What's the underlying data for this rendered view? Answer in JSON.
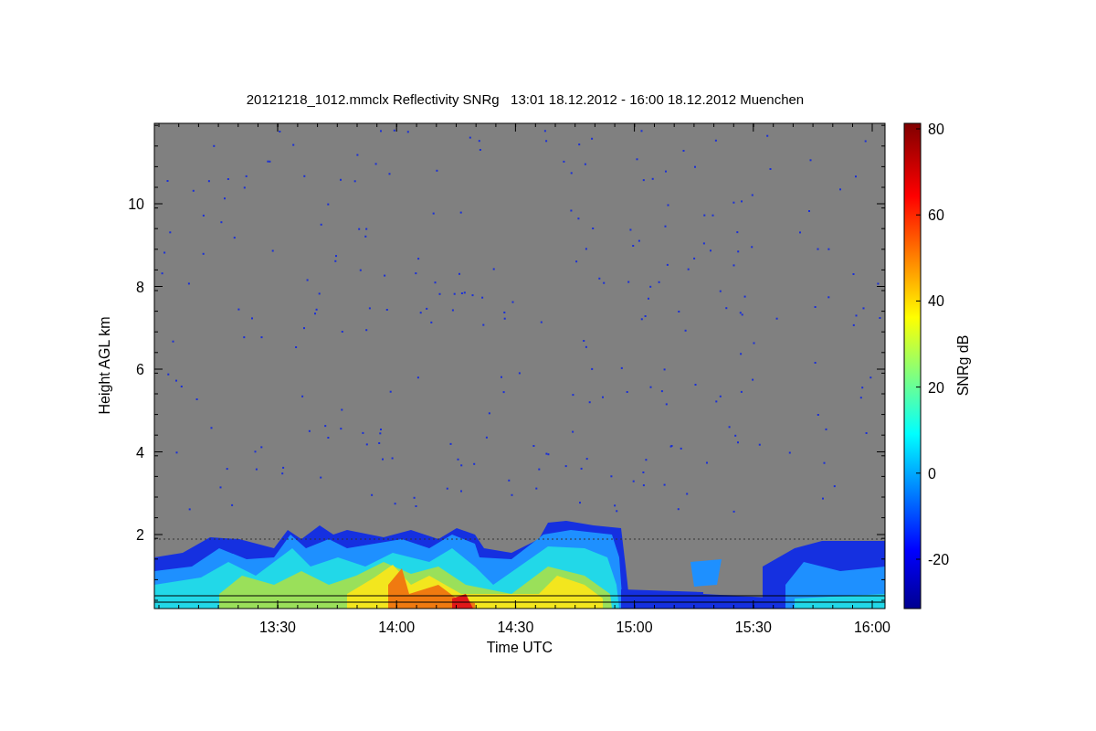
{
  "chart": {
    "title": "20121218_1012.mmclx Reflectivity SNRg   13:01 18.12.2012 - 16:00 18.12.2012 Muenchen",
    "y_axis": {
      "label": "Height AGL km",
      "ticks": [
        "10",
        "8",
        "6",
        "4",
        "2"
      ]
    },
    "x_axis": {
      "label": "Time UTC",
      "ticks": [
        "13:30",
        "14:00",
        "14:30",
        "15:00",
        "15:30",
        "16:00"
      ]
    },
    "colorbar": {
      "label": "SNRg dB",
      "ticks": [
        "80",
        "60",
        "40",
        "20",
        "0",
        "-20"
      ]
    }
  }
}
